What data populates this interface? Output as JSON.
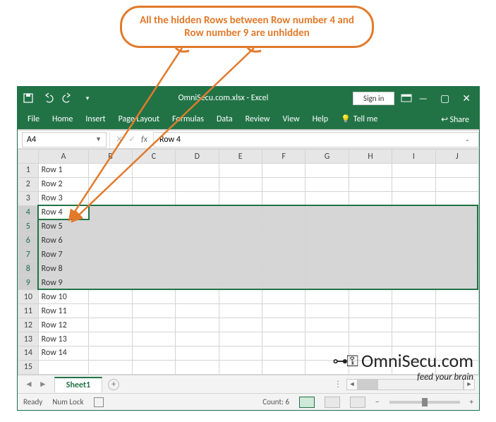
{
  "callout_text": "All the hidden Rows between  Row number 4 and Row number 9 are unhidden",
  "titlebar": {
    "filename": "OmniSecu.com.xlsx - Excel",
    "signin": "Sign in"
  },
  "ribbon": {
    "file": "File",
    "home": "Home",
    "insert": "Insert",
    "page_layout": "Page Layout",
    "formulas": "Formulas",
    "data": "Data",
    "review": "Review",
    "view": "View",
    "help": "Help",
    "tellme": "Tell me",
    "share": "Share"
  },
  "namebox_value": "A4",
  "formula_value": "Row 4",
  "columns": [
    "A",
    "B",
    "C",
    "D",
    "E",
    "F",
    "G",
    "H",
    "I",
    "J"
  ],
  "rows": [
    {
      "n": "1",
      "val": "Row 1",
      "sel": false
    },
    {
      "n": "2",
      "val": "Row 2",
      "sel": false
    },
    {
      "n": "3",
      "val": "Row 3",
      "sel": false
    },
    {
      "n": "4",
      "val": "Row 4",
      "sel": true,
      "active": true
    },
    {
      "n": "5",
      "val": "Row 5",
      "sel": true
    },
    {
      "n": "6",
      "val": "Row 6",
      "sel": true
    },
    {
      "n": "7",
      "val": "Row 7",
      "sel": true
    },
    {
      "n": "8",
      "val": "Row 8",
      "sel": true
    },
    {
      "n": "9",
      "val": "Row 9",
      "sel": true
    },
    {
      "n": "10",
      "val": "Row 10",
      "sel": false
    },
    {
      "n": "11",
      "val": "Row 11",
      "sel": false
    },
    {
      "n": "12",
      "val": "Row 12",
      "sel": false
    },
    {
      "n": "13",
      "val": "Row 13",
      "sel": false
    },
    {
      "n": "14",
      "val": "Row 14",
      "sel": false
    },
    {
      "n": "15",
      "val": "",
      "sel": false
    }
  ],
  "sheet_tab": "Sheet1",
  "status": {
    "ready": "Ready",
    "numlock": "Num Lock",
    "count_label": "Count: 6",
    "zoom_minus": "−",
    "zoom_plus": "+"
  },
  "watermark": {
    "brand": "OmniSecu.com",
    "tag": "feed your brain"
  }
}
